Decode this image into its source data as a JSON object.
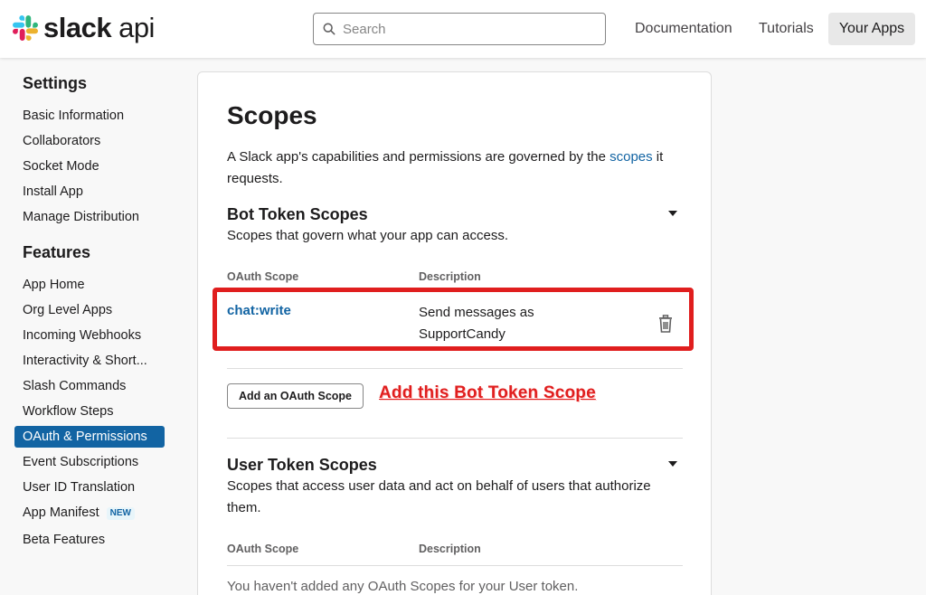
{
  "header": {
    "brand": "slack",
    "brand_suffix": "api",
    "search_placeholder": "Search",
    "nav": {
      "documentation": "Documentation",
      "tutorials": "Tutorials",
      "your_apps": "Your Apps"
    }
  },
  "sidebar": {
    "settings_heading": "Settings",
    "settings_items": [
      "Basic Information",
      "Collaborators",
      "Socket Mode",
      "Install App",
      "Manage Distribution"
    ],
    "features_heading": "Features",
    "features_items": [
      "App Home",
      "Org Level Apps",
      "Incoming Webhooks",
      "Interactivity & Short...",
      "Slash Commands",
      "Workflow Steps",
      "OAuth & Permissions",
      "Event Subscriptions",
      "User ID Translation",
      "App Manifest",
      "Beta Features"
    ],
    "active_item": "OAuth & Permissions",
    "new_badge": "NEW"
  },
  "main": {
    "title": "Scopes",
    "intro_before": "A Slack app's capabilities and permissions are governed by the ",
    "intro_link": "scopes",
    "intro_after": " it requests.",
    "bot": {
      "title": "Bot Token Scopes",
      "subtitle": "Scopes that govern what your app can access.",
      "col_scope": "OAuth Scope",
      "col_desc": "Description",
      "scopes": [
        {
          "name": "chat:write",
          "description": "Send messages as SupportCandy"
        }
      ],
      "add_button": "Add an OAuth Scope",
      "annotation": "Add this Bot Token Scope"
    },
    "user": {
      "title": "User Token Scopes",
      "subtitle": "Scopes that access user data and act on behalf of users that authorize them.",
      "col_scope": "OAuth Scope",
      "col_desc": "Description",
      "empty_note": "You haven't added any OAuth Scopes for your User token."
    }
  },
  "colors": {
    "link": "#1264a3",
    "active_nav": "#1264a3",
    "annotation_red": "#e01e1e"
  }
}
